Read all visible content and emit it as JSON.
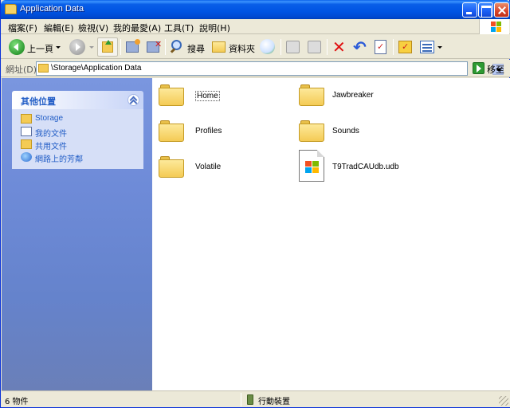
{
  "window": {
    "title": "Application Data"
  },
  "menu": [
    "檔案(F)",
    "編輯(E)",
    "檢視(V)",
    "我的最愛(A)",
    "工具(T)",
    "說明(H)"
  ],
  "toolbar": {
    "back_label": "上一頁",
    "search_label": "搜尋",
    "folders_label": "資料夾"
  },
  "address": {
    "label": "網址(D)",
    "path": "\\Storage\\Application Data",
    "go_label": "移至"
  },
  "left_panel": {
    "title": "其他位置",
    "links": [
      "Storage",
      "我的文件",
      "共用文件",
      "網路上的芳鄰"
    ]
  },
  "items": [
    {
      "name": "Home",
      "type": "folder"
    },
    {
      "name": "Jawbreaker",
      "type": "folder"
    },
    {
      "name": "Profiles",
      "type": "folder"
    },
    {
      "name": "Sounds",
      "type": "folder"
    },
    {
      "name": "Volatile",
      "type": "folder"
    },
    {
      "name": "T9TradCAUdb.udb",
      "type": "file"
    }
  ],
  "status": {
    "count": "6 物件",
    "location": "行動裝置"
  },
  "colors": {
    "titlebar": "#0054e3",
    "panel_link": "#215dc6",
    "left_pane": "#6e8bd8"
  }
}
